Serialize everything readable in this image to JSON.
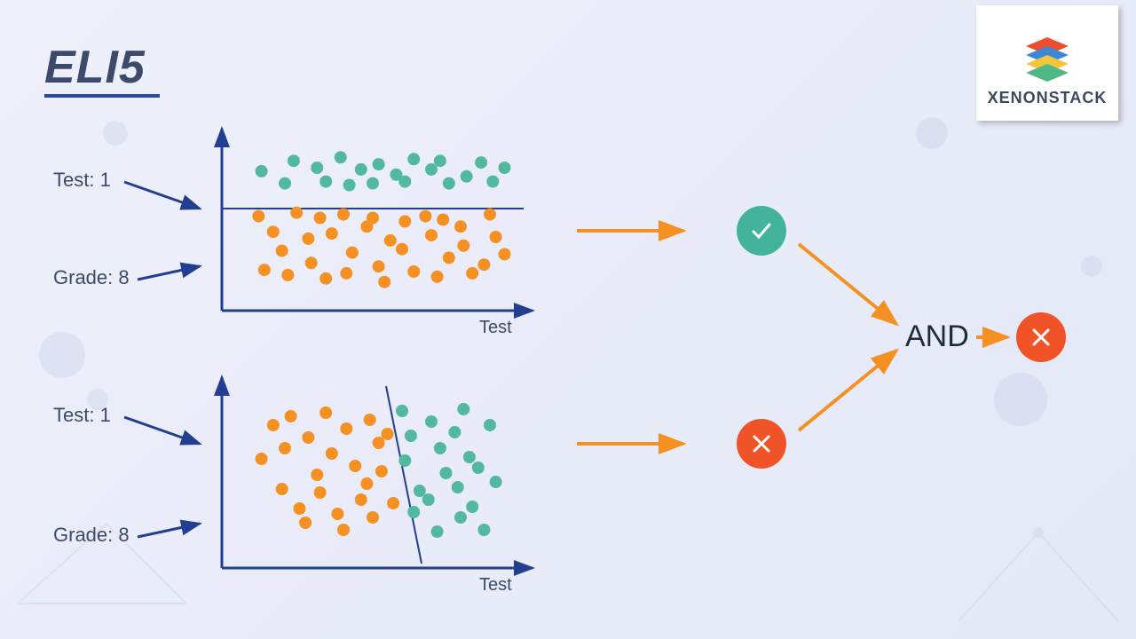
{
  "title": "ELI5",
  "brand": "XENONSTACK",
  "colors": {
    "axis": "#233d91",
    "arrow_orange": "#f59123",
    "dot_green": "#52b8a0",
    "dot_orange": "#f59123",
    "badge_green": "#44b39b",
    "badge_red": "#ef5327",
    "text": "#3d4a6a"
  },
  "plots": {
    "top": {
      "labels": {
        "test": "Test: 1",
        "grade": "Grade: 8",
        "xaxis": "Test"
      },
      "separator": "horizontal",
      "result": "pass"
    },
    "bottom": {
      "labels": {
        "test": "Test: 1",
        "grade": "Grade: 8",
        "xaxis": "Test"
      },
      "separator": "diagonal",
      "result": "fail"
    }
  },
  "gate": {
    "label": "AND",
    "output": "fail"
  },
  "chart_data": [
    {
      "type": "scatter",
      "title": "Plot 1 (horizontal split)",
      "xlabel": "Test",
      "ylabel": "",
      "series": [
        {
          "name": "green",
          "points": [
            [
              1.2,
              7.8
            ],
            [
              2.0,
              7.1
            ],
            [
              2.3,
              8.4
            ],
            [
              3.1,
              8.0
            ],
            [
              3.4,
              7.2
            ],
            [
              3.9,
              8.6
            ],
            [
              4.6,
              7.9
            ],
            [
              4.2,
              7.0
            ],
            [
              5.2,
              8.2
            ],
            [
              5.0,
              7.1
            ],
            [
              5.8,
              7.6
            ],
            [
              6.4,
              8.5
            ],
            [
              6.1,
              7.2
            ],
            [
              7.0,
              7.9
            ],
            [
              7.6,
              7.1
            ],
            [
              7.3,
              8.4
            ],
            [
              8.2,
              7.5
            ],
            [
              8.7,
              8.3
            ],
            [
              9.1,
              7.2
            ],
            [
              9.5,
              8.0
            ]
          ]
        },
        {
          "name": "orange",
          "points": [
            [
              1.1,
              5.2
            ],
            [
              1.6,
              4.3
            ],
            [
              1.3,
              2.1
            ],
            [
              1.9,
              3.2
            ],
            [
              2.4,
              5.4
            ],
            [
              2.1,
              1.8
            ],
            [
              2.8,
              3.9
            ],
            [
              3.2,
              5.1
            ],
            [
              2.9,
              2.5
            ],
            [
              3.6,
              4.2
            ],
            [
              3.4,
              1.6
            ],
            [
              4.0,
              5.3
            ],
            [
              4.3,
              3.1
            ],
            [
              4.1,
              1.9
            ],
            [
              4.8,
              4.6
            ],
            [
              5.2,
              2.3
            ],
            [
              5.0,
              5.1
            ],
            [
              5.6,
              3.8
            ],
            [
              5.4,
              1.4
            ],
            [
              6.1,
              4.9
            ],
            [
              6.4,
              2.0
            ],
            [
              6.0,
              3.3
            ],
            [
              6.8,
              5.2
            ],
            [
              7.2,
              1.7
            ],
            [
              7.0,
              4.1
            ],
            [
              7.6,
              2.8
            ],
            [
              7.4,
              5.0
            ],
            [
              8.1,
              3.5
            ],
            [
              8.4,
              1.9
            ],
            [
              8.0,
              4.6
            ],
            [
              8.8,
              2.4
            ],
            [
              9.2,
              4.0
            ],
            [
              9.0,
              5.3
            ],
            [
              9.5,
              3.0
            ]
          ]
        }
      ],
      "boundary": {
        "type": "horizontal",
        "y": 6.4
      },
      "xlim": [
        0,
        10
      ],
      "ylim": [
        0,
        10
      ]
    },
    {
      "type": "scatter",
      "title": "Plot 2 (diagonal split)",
      "xlabel": "Test",
      "ylabel": "",
      "series": [
        {
          "name": "orange",
          "points": [
            [
              1.6,
              7.8
            ],
            [
              1.2,
              5.9
            ],
            [
              1.9,
              4.2
            ],
            [
              2.2,
              8.3
            ],
            [
              2.0,
              6.5
            ],
            [
              2.5,
              3.1
            ],
            [
              2.8,
              7.1
            ],
            [
              3.1,
              5.0
            ],
            [
              2.7,
              2.3
            ],
            [
              3.4,
              8.5
            ],
            [
              3.6,
              6.2
            ],
            [
              3.2,
              4.0
            ],
            [
              3.8,
              2.8
            ],
            [
              4.1,
              7.6
            ],
            [
              4.4,
              5.5
            ],
            [
              4.0,
              1.9
            ],
            [
              4.6,
              3.6
            ],
            [
              4.9,
              8.1
            ],
            [
              5.2,
              6.8
            ],
            [
              4.8,
              4.5
            ],
            [
              5.0,
              2.6
            ],
            [
              5.5,
              7.3
            ],
            [
              5.3,
              5.2
            ],
            [
              5.7,
              3.4
            ]
          ]
        },
        {
          "name": "green",
          "points": [
            [
              6.0,
              8.6
            ],
            [
              6.3,
              7.2
            ],
            [
              6.1,
              5.8
            ],
            [
              6.6,
              4.1
            ],
            [
              6.4,
              2.9
            ],
            [
              7.0,
              8.0
            ],
            [
              7.3,
              6.5
            ],
            [
              6.9,
              3.6
            ],
            [
              7.5,
              5.1
            ],
            [
              7.2,
              1.8
            ],
            [
              7.8,
              7.4
            ],
            [
              8.1,
              8.7
            ],
            [
              7.9,
              4.3
            ],
            [
              8.3,
              6.0
            ],
            [
              8.0,
              2.6
            ],
            [
              8.6,
              5.4
            ],
            [
              8.4,
              3.2
            ],
            [
              9.0,
              7.8
            ],
            [
              8.8,
              1.9
            ],
            [
              9.2,
              4.6
            ]
          ]
        }
      ],
      "boundary": {
        "type": "line",
        "x1": 5.6,
        "y1": 9.5,
        "x2": 6.8,
        "y2": 0.5
      },
      "xlim": [
        0,
        10
      ],
      "ylim": [
        0,
        10
      ]
    }
  ]
}
